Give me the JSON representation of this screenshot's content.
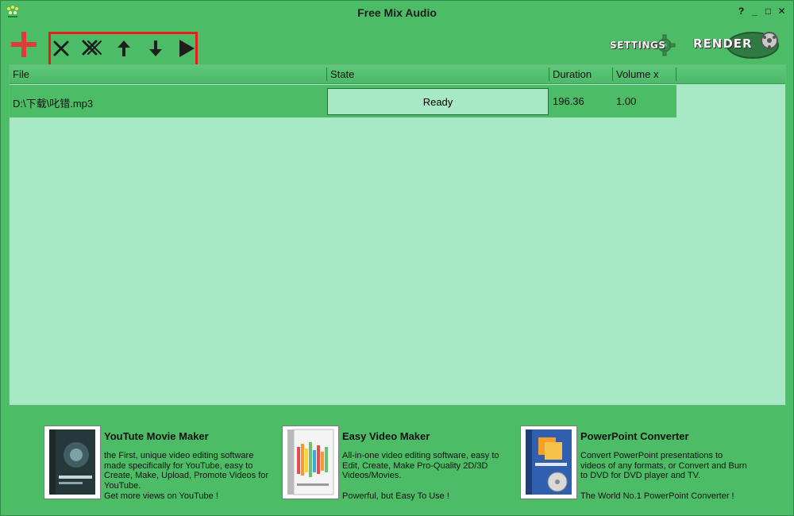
{
  "window": {
    "title": "Free Mix Audio",
    "controls": [
      "?",
      "_",
      "□",
      "✕"
    ]
  },
  "toolbar": {
    "settings_label": "SETTINGS",
    "render_label": "RENDER"
  },
  "list": {
    "columns": [
      "File",
      "State",
      "Duration",
      "Volume x"
    ],
    "rows": [
      {
        "file": "D:\\下载\\叱错.mp3",
        "state": "Ready",
        "duration": "196.36",
        "volume": "1.00"
      }
    ]
  },
  "promos": [
    {
      "title": "YouTute Movie Maker",
      "desc": "the First, unique video editing software made specifically for YouTube, easy to Create, Make, Upload, Promote Videos for YouTube.",
      "tagline": "Get more views on YouTube !"
    },
    {
      "title": "Easy Video Maker",
      "desc": "All-in-one video editing software, easy to Edit, Create, Make Pro-Quality 2D/3D Videos/Movies.",
      "tagline": "Powerful, but Easy To Use !"
    },
    {
      "title": "PowerPoint Converter",
      "desc": "Convert PowerPoint presentations to videos of any formats, or Convert and Burn to DVD for DVD player and TV.",
      "tagline": "The World No.1 PowerPoint Converter !"
    }
  ],
  "colors": {
    "window_bg": "#4cbd66",
    "list_bg": "#a8e9c5",
    "highlight": "#e81a1a",
    "add_icon": "#e23a3a"
  }
}
